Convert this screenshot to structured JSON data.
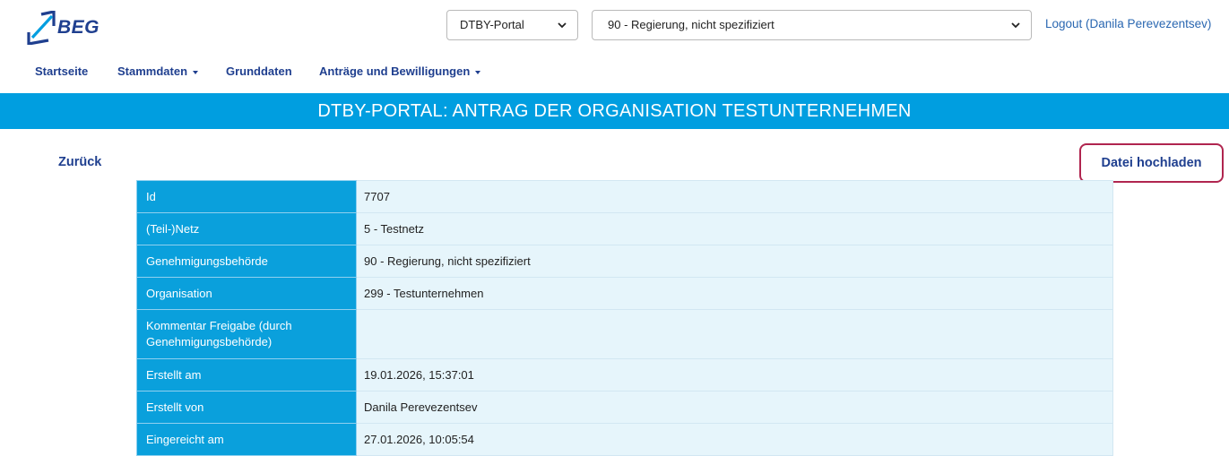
{
  "brand": {
    "logo_text": "BEG"
  },
  "header": {
    "portal_select": {
      "value": "DTBY-Portal"
    },
    "authority_select": {
      "value": "90 - Regierung, nicht spezifiziert"
    },
    "logout_label": "Logout (Danila Perevezentsev)"
  },
  "nav": {
    "items": [
      {
        "label": "Startseite",
        "dropdown": false
      },
      {
        "label": "Stammdaten",
        "dropdown": true
      },
      {
        "label": "Grunddaten",
        "dropdown": false
      },
      {
        "label": "Anträge und Bewilligungen",
        "dropdown": true
      }
    ]
  },
  "page": {
    "title": "DTBY-PORTAL: ANTRAG DER ORGANISATION TESTUNTERNEHMEN",
    "back_label": "Zurück",
    "upload_label": "Datei hochladen"
  },
  "details": {
    "rows": [
      {
        "label": "Id",
        "value": "7707"
      },
      {
        "label": "(Teil-)Netz",
        "value": "5 - Testnetz"
      },
      {
        "label": "Genehmigungsbehörde",
        "value": "90 - Regierung, nicht spezifiziert"
      },
      {
        "label": "Organisation",
        "value": "299 - Testunternehmen"
      },
      {
        "label": "Kommentar Freigabe (durch Genehmigungsbehörde)",
        "value": ""
      },
      {
        "label": "Erstellt am",
        "value": "19.01.2026, 15:37:01"
      },
      {
        "label": "Erstellt von",
        "value": "Danila Perevezentsev"
      },
      {
        "label": "Eingereicht am",
        "value": "27.01.2026, 10:05:54"
      }
    ]
  },
  "colors": {
    "banner": "#009ee0",
    "nav_text": "#1f3f8f",
    "link": "#2a67b1",
    "label_cell": "#0aa0dc",
    "value_cell": "#e6f5fb",
    "highlight_border": "#b0254f"
  },
  "icons": {
    "select_chevron": "chevron-down-icon",
    "logo_mark": "beg-logo-mark-icon"
  }
}
